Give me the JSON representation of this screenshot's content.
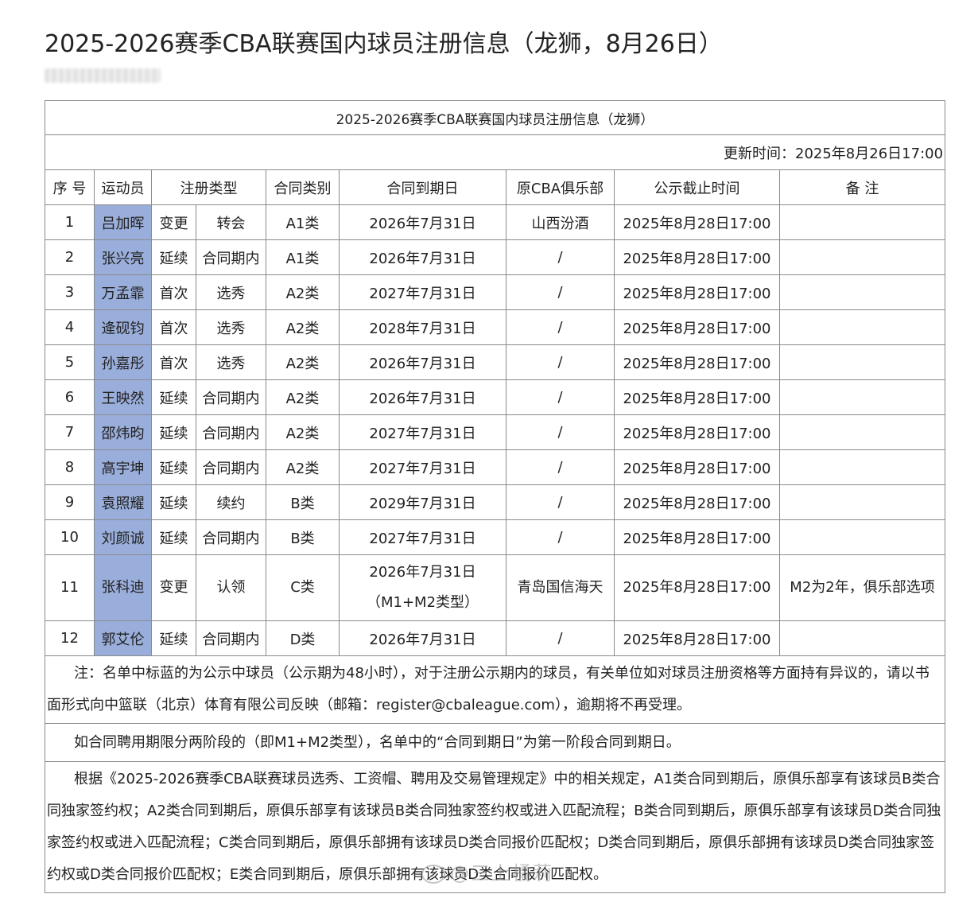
{
  "page": {
    "title": "2025-2026赛季CBA联赛国内球员注册信息（龙狮，8月26日）"
  },
  "table": {
    "caption": "2025-2026赛季CBA联赛国内球员注册信息（龙狮）",
    "update_time": "更新时间：2025年8月26日17:00",
    "headers": {
      "no": "序 号",
      "player": "运动员",
      "reg_type": "注册类型",
      "contract_class": "合同类别",
      "expiry": "合同到期日",
      "former_club": "原CBA俱乐部",
      "deadline": "公示截止时间",
      "remark": "备 注"
    },
    "rows": [
      {
        "no": "1",
        "player": "吕加晖",
        "reg_a": "变更",
        "reg_b": "转会",
        "class": "A1类",
        "expiry": "2026年7月31日",
        "club": "山西汾酒",
        "deadline": "2025年8月28日17:00",
        "remark": ""
      },
      {
        "no": "2",
        "player": "张兴亮",
        "reg_a": "延续",
        "reg_b": "合同期内",
        "class": "A1类",
        "expiry": "2026年7月31日",
        "club": "/",
        "deadline": "2025年8月28日17:00",
        "remark": ""
      },
      {
        "no": "3",
        "player": "万孟霏",
        "reg_a": "首次",
        "reg_b": "选秀",
        "class": "A2类",
        "expiry": "2027年7月31日",
        "club": "/",
        "deadline": "2025年8月28日17:00",
        "remark": ""
      },
      {
        "no": "4",
        "player": "逄砚钧",
        "reg_a": "首次",
        "reg_b": "选秀",
        "class": "A2类",
        "expiry": "2028年7月31日",
        "club": "/",
        "deadline": "2025年8月28日17:00",
        "remark": ""
      },
      {
        "no": "5",
        "player": "孙嘉彤",
        "reg_a": "首次",
        "reg_b": "选秀",
        "class": "A2类",
        "expiry": "2026年7月31日",
        "club": "/",
        "deadline": "2025年8月28日17:00",
        "remark": ""
      },
      {
        "no": "6",
        "player": "王映然",
        "reg_a": "延续",
        "reg_b": "合同期内",
        "class": "A2类",
        "expiry": "2026年7月31日",
        "club": "/",
        "deadline": "2025年8月28日17:00",
        "remark": ""
      },
      {
        "no": "7",
        "player": "邵炜昀",
        "reg_a": "延续",
        "reg_b": "合同期内",
        "class": "A2类",
        "expiry": "2027年7月31日",
        "club": "/",
        "deadline": "2025年8月28日17:00",
        "remark": ""
      },
      {
        "no": "8",
        "player": "高宇坤",
        "reg_a": "延续",
        "reg_b": "合同期内",
        "class": "A2类",
        "expiry": "2027年7月31日",
        "club": "/",
        "deadline": "2025年8月28日17:00",
        "remark": ""
      },
      {
        "no": "9",
        "player": "袁照耀",
        "reg_a": "延续",
        "reg_b": "续约",
        "class": "B类",
        "expiry": "2029年7月31日",
        "club": "/",
        "deadline": "2025年8月28日17:00",
        "remark": ""
      },
      {
        "no": "10",
        "player": "刘颜诚",
        "reg_a": "延续",
        "reg_b": "合同期内",
        "class": "B类",
        "expiry": "2027年7月31日",
        "club": "/",
        "deadline": "2025年8月28日17:00",
        "remark": ""
      }
    ],
    "row11": {
      "no": "11",
      "player": "张科迪",
      "reg_a": "变更",
      "reg_b": "认领",
      "class": "C类",
      "expiry_line1": "2026年7月31日",
      "expiry_line2": "（M1+M2类型）",
      "club": "青岛国信海天",
      "deadline": "2025年8月28日17:00",
      "remark": "M2为2年，俱乐部选项"
    },
    "row12": {
      "no": "12",
      "player": "郭艾伦",
      "reg_a": "延续",
      "reg_b": "合同期内",
      "class": "D类",
      "expiry": "2026年7月31日",
      "club": "/",
      "deadline": "2025年8月28日17:00",
      "remark": ""
    },
    "notes": {
      "note1": "注：名单中标蓝的为公示中球员（公示期为48小时），对于注册公示期内的球员，有关单位如对球员注册资格等方面持有异议的，请以书面形式向中篮联（北京）体育有限公司反映（邮箱：register@cbaleague.com），逾期将不再受理。",
      "note2": "如合同聘用期限分两阶段的（即M1+M2类型），名单中的“合同到期日”为第一阶段合同到期日。",
      "note3": "根据《2025-2026赛季CBA联赛球员选秀、工资帽、聘用及交易管理规定》中的相关规定，A1类合同到期后，原俱乐部享有该球员B类合同独家签约权；A2类合同到期后，原俱乐部享有该球员B类合同独家签约权或进入匹配流程；B类合同到期后，原俱乐部享有该球员D类合同独家签约权或进入匹配流程；C类合同到期后，原俱乐部拥有该球员D类合同报价匹配权；D类合同到期后，原俱乐部拥有该球员D类合同独家签约权或D类合同报价匹配权；E类合同到期后，原俱乐部拥有该球员D类合同报价匹配权。"
    }
  },
  "watermark": {
    "text": "@三上橘莉"
  }
}
